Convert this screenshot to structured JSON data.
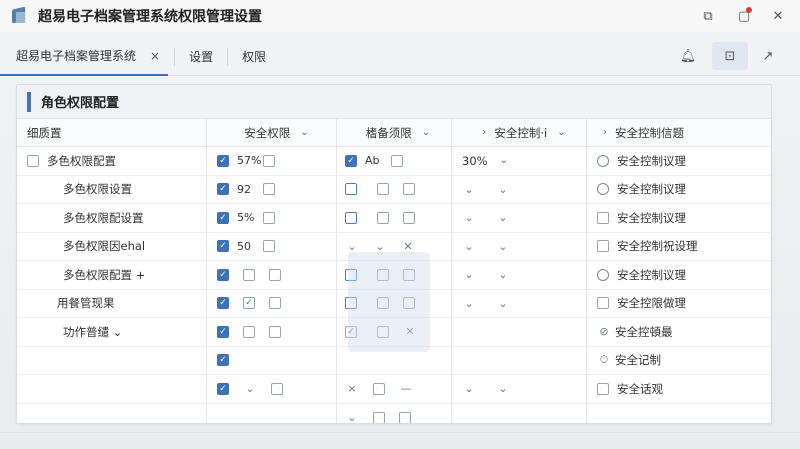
{
  "window": {
    "title": "超易电子档案管理系统权限管理设置",
    "icons": [
      "app-logo",
      "restore-icon",
      "notification-icon",
      "close-icon"
    ]
  },
  "tabs": [
    {
      "label": "超易电子档案管理系统",
      "active": true,
      "close": "×"
    },
    {
      "label": "设置"
    },
    {
      "label": "权限"
    }
  ],
  "toolbar_icons": [
    "bell-icon",
    "export-icon",
    "share-icon"
  ],
  "panel": {
    "title": "角色权限配置"
  },
  "headers": [
    "细质置",
    "安全权限",
    "榰备须限",
    "安全控制·i",
    "安全控制信题"
  ],
  "rows": [
    {
      "name": "多色权限配置",
      "c1_val": "57%",
      "c2_val": "Ab",
      "c3_val": "30%",
      "c4": "安全控制议理"
    },
    {
      "name": "多色权限设置",
      "c1_val": "92",
      "c2_val": "",
      "c3_val": "",
      "c4": "安全控制议理"
    },
    {
      "name": "多色权限配设置",
      "c1_val": "5%",
      "c2_val": "",
      "c3_val": "",
      "c4": "安全控制议理"
    },
    {
      "name": "多色权限因ehal",
      "c1_val": "50",
      "c2_val": "",
      "c3_val": "",
      "c4": "安全控制祝设理"
    },
    {
      "name": "多色权限配置 +",
      "c1_val": "",
      "c2_val": "",
      "c3_val": "",
      "c4": "安全控制议理"
    },
    {
      "name": "用餐管现果",
      "c1_val": "",
      "c2_val": "",
      "c3_val": "",
      "c4": "安全控限做理"
    },
    {
      "name": "功作普缱 ⌄",
      "c1_val": "",
      "c2_val": "",
      "c3_val": "",
      "c4": "安全控頓最"
    },
    {
      "name": "",
      "c1_val": "",
      "c2_val": "",
      "c3_val": "",
      "c4": "安全记制"
    },
    {
      "name": "",
      "c1_val": "",
      "c2_val": "",
      "c3_val": "",
      "c4": "安全话观"
    },
    {
      "name": "",
      "c1_val": "",
      "c2_val": "",
      "c3_val": "",
      "c4": ""
    }
  ],
  "colors": {
    "accent": "#3f72b5",
    "panel_bar": "#4a74ad",
    "badge": "#e03b3b"
  }
}
